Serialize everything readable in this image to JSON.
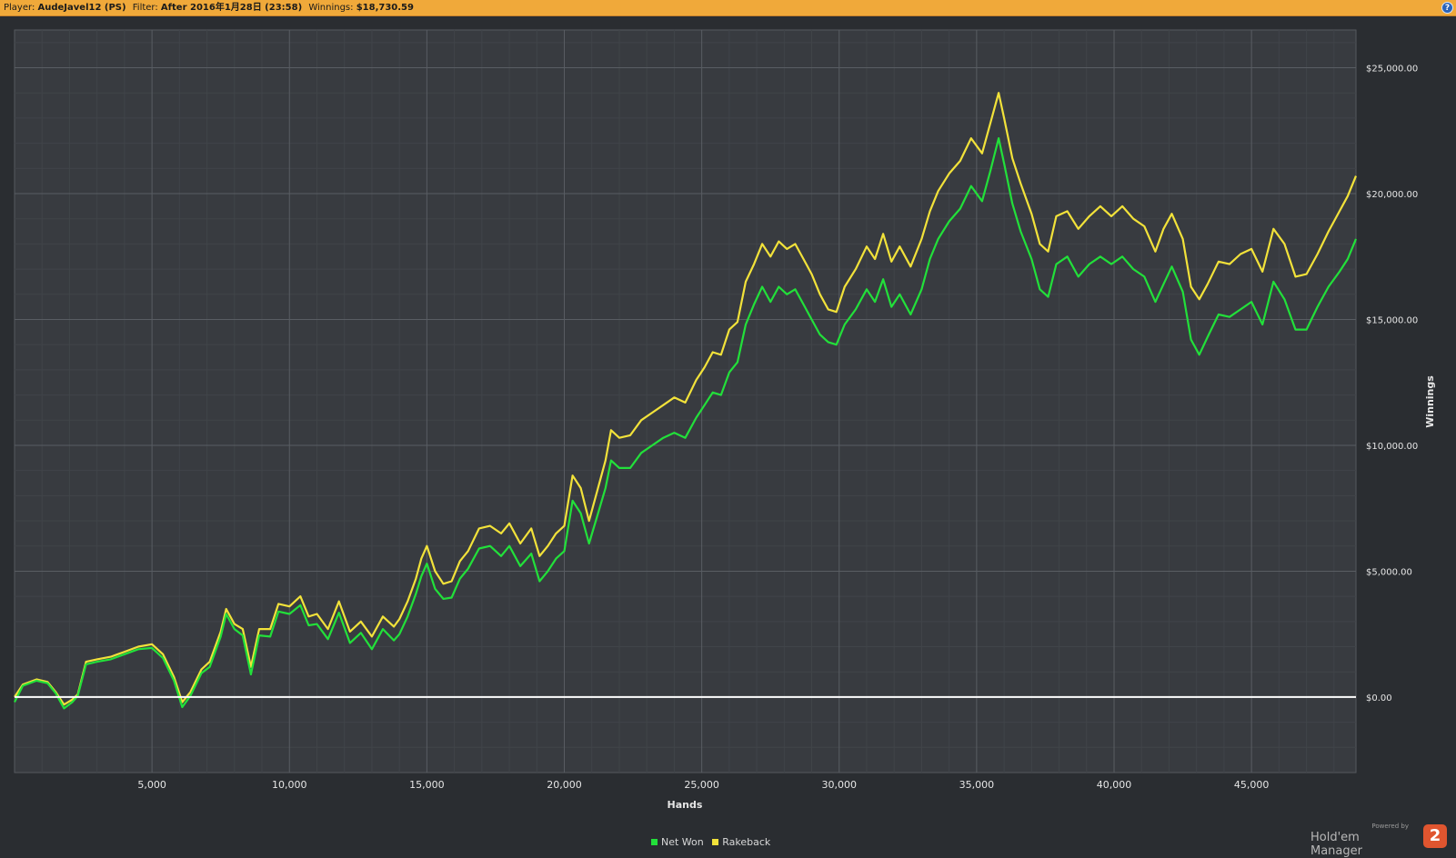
{
  "header": {
    "player_label": "Player:",
    "player_value": "AudeJavel12 (PS)",
    "filter_label": "Filter:",
    "filter_value": "After 2016年1月28日 (23:58)",
    "winnings_label": "Winnings:",
    "winnings_value": "$18,730.59",
    "help_icon": "?"
  },
  "chart_data": {
    "type": "line",
    "xlabel": "Hands",
    "ylabel": "Winnings",
    "xlim": [
      0,
      48800
    ],
    "ylim": [
      -3000,
      26500
    ],
    "x_ticks": [
      {
        "value": 5000,
        "label": "5,000"
      },
      {
        "value": 10000,
        "label": "10,000"
      },
      {
        "value": 15000,
        "label": "15,000"
      },
      {
        "value": 20000,
        "label": "20,000"
      },
      {
        "value": 25000,
        "label": "25,000"
      },
      {
        "value": 30000,
        "label": "30,000"
      },
      {
        "value": 35000,
        "label": "35,000"
      },
      {
        "value": 40000,
        "label": "40,000"
      },
      {
        "value": 45000,
        "label": "45,000"
      }
    ],
    "y_ticks": [
      {
        "value": 0,
        "label": "$0.00"
      },
      {
        "value": 5000,
        "label": "$5,000.00"
      },
      {
        "value": 10000,
        "label": "$10,000.00"
      },
      {
        "value": 15000,
        "label": "$15,000.00"
      },
      {
        "value": 20000,
        "label": "$20,000.00"
      },
      {
        "value": 25000,
        "label": "$25,000.00"
      }
    ],
    "grid": true,
    "legend_position": "bottom-center",
    "colors": {
      "net_won": "#22e03a",
      "rakeback": "#f2e23a",
      "zero_line": "#ffffff",
      "plot_bg": "#383b40",
      "grid": "#4e5257"
    },
    "series": [
      {
        "name": "Rakeback",
        "color": "#f2e23a",
        "points": [
          [
            0,
            0
          ],
          [
            300,
            500
          ],
          [
            800,
            700
          ],
          [
            1200,
            600
          ],
          [
            1500,
            200
          ],
          [
            1800,
            -300
          ],
          [
            2100,
            -100
          ],
          [
            2300,
            100
          ],
          [
            2600,
            1400
          ],
          [
            3000,
            1500
          ],
          [
            3500,
            1600
          ],
          [
            4000,
            1800
          ],
          [
            4500,
            2000
          ],
          [
            5000,
            2100
          ],
          [
            5400,
            1700
          ],
          [
            5800,
            800
          ],
          [
            6100,
            -200
          ],
          [
            6400,
            200
          ],
          [
            6800,
            1100
          ],
          [
            7100,
            1400
          ],
          [
            7500,
            2600
          ],
          [
            7700,
            3500
          ],
          [
            8000,
            2900
          ],
          [
            8300,
            2700
          ],
          [
            8600,
            1200
          ],
          [
            8900,
            2700
          ],
          [
            9300,
            2700
          ],
          [
            9600,
            3700
          ],
          [
            10000,
            3600
          ],
          [
            10400,
            4000
          ],
          [
            10700,
            3200
          ],
          [
            11000,
            3300
          ],
          [
            11400,
            2700
          ],
          [
            11800,
            3800
          ],
          [
            12200,
            2600
          ],
          [
            12600,
            3000
          ],
          [
            13000,
            2400
          ],
          [
            13400,
            3200
          ],
          [
            13800,
            2800
          ],
          [
            14000,
            3100
          ],
          [
            14300,
            3800
          ],
          [
            14600,
            4700
          ],
          [
            14800,
            5500
          ],
          [
            15000,
            6000
          ],
          [
            15300,
            5000
          ],
          [
            15600,
            4500
          ],
          [
            15900,
            4600
          ],
          [
            16200,
            5400
          ],
          [
            16500,
            5800
          ],
          [
            16900,
            6700
          ],
          [
            17300,
            6800
          ],
          [
            17700,
            6500
          ],
          [
            18000,
            6900
          ],
          [
            18400,
            6100
          ],
          [
            18800,
            6700
          ],
          [
            19100,
            5600
          ],
          [
            19400,
            6000
          ],
          [
            19700,
            6500
          ],
          [
            20000,
            6800
          ],
          [
            20300,
            8800
          ],
          [
            20600,
            8300
          ],
          [
            20900,
            7000
          ],
          [
            21200,
            8200
          ],
          [
            21500,
            9400
          ],
          [
            21700,
            10600
          ],
          [
            22000,
            10300
          ],
          [
            22400,
            10400
          ],
          [
            22800,
            11000
          ],
          [
            23200,
            11300
          ],
          [
            23600,
            11600
          ],
          [
            24000,
            11900
          ],
          [
            24400,
            11700
          ],
          [
            24800,
            12600
          ],
          [
            25100,
            13100
          ],
          [
            25400,
            13700
          ],
          [
            25700,
            13600
          ],
          [
            26000,
            14600
          ],
          [
            26300,
            14900
          ],
          [
            26600,
            16500
          ],
          [
            26900,
            17200
          ],
          [
            27200,
            18000
          ],
          [
            27500,
            17500
          ],
          [
            27800,
            18100
          ],
          [
            28100,
            17800
          ],
          [
            28400,
            18000
          ],
          [
            28700,
            17400
          ],
          [
            29000,
            16800
          ],
          [
            29300,
            16000
          ],
          [
            29600,
            15400
          ],
          [
            29900,
            15300
          ],
          [
            30200,
            16300
          ],
          [
            30600,
            17000
          ],
          [
            31000,
            17900
          ],
          [
            31300,
            17400
          ],
          [
            31600,
            18400
          ],
          [
            31900,
            17300
          ],
          [
            32200,
            17900
          ],
          [
            32600,
            17100
          ],
          [
            33000,
            18200
          ],
          [
            33300,
            19300
          ],
          [
            33600,
            20100
          ],
          [
            34000,
            20800
          ],
          [
            34400,
            21300
          ],
          [
            34800,
            22200
          ],
          [
            35200,
            21600
          ],
          [
            35500,
            22800
          ],
          [
            35800,
            24000
          ],
          [
            36000,
            23000
          ],
          [
            36300,
            21400
          ],
          [
            36600,
            20400
          ],
          [
            37000,
            19200
          ],
          [
            37300,
            18000
          ],
          [
            37600,
            17700
          ],
          [
            37900,
            19100
          ],
          [
            38300,
            19300
          ],
          [
            38700,
            18600
          ],
          [
            39100,
            19100
          ],
          [
            39500,
            19500
          ],
          [
            39900,
            19100
          ],
          [
            40300,
            19500
          ],
          [
            40700,
            19000
          ],
          [
            41100,
            18700
          ],
          [
            41500,
            17700
          ],
          [
            41800,
            18600
          ],
          [
            42100,
            19200
          ],
          [
            42500,
            18200
          ],
          [
            42800,
            16300
          ],
          [
            43100,
            15800
          ],
          [
            43400,
            16400
          ],
          [
            43800,
            17300
          ],
          [
            44200,
            17200
          ],
          [
            44600,
            17600
          ],
          [
            45000,
            17800
          ],
          [
            45400,
            16900
          ],
          [
            45800,
            18600
          ],
          [
            46200,
            18000
          ],
          [
            46600,
            16700
          ],
          [
            47000,
            16800
          ],
          [
            47400,
            17600
          ],
          [
            47800,
            18500
          ],
          [
            48200,
            19300
          ],
          [
            48500,
            19900
          ],
          [
            48800,
            20700
          ]
        ]
      },
      {
        "name": "Net Won",
        "color": "#22e03a",
        "points": [
          [
            0,
            -200
          ],
          [
            300,
            450
          ],
          [
            800,
            650
          ],
          [
            1200,
            550
          ],
          [
            1500,
            150
          ],
          [
            1800,
            -450
          ],
          [
            2100,
            -200
          ],
          [
            2300,
            50
          ],
          [
            2600,
            1300
          ],
          [
            3000,
            1400
          ],
          [
            3500,
            1500
          ],
          [
            4000,
            1700
          ],
          [
            4500,
            1900
          ],
          [
            5000,
            1950
          ],
          [
            5400,
            1550
          ],
          [
            5800,
            650
          ],
          [
            6100,
            -400
          ],
          [
            6400,
            50
          ],
          [
            6800,
            950
          ],
          [
            7100,
            1200
          ],
          [
            7500,
            2400
          ],
          [
            7700,
            3300
          ],
          [
            8000,
            2700
          ],
          [
            8300,
            2450
          ],
          [
            8600,
            900
          ],
          [
            8900,
            2450
          ],
          [
            9300,
            2400
          ],
          [
            9600,
            3400
          ],
          [
            10000,
            3300
          ],
          [
            10400,
            3650
          ],
          [
            10700,
            2850
          ],
          [
            11000,
            2900
          ],
          [
            11400,
            2300
          ],
          [
            11800,
            3350
          ],
          [
            12200,
            2150
          ],
          [
            12600,
            2550
          ],
          [
            13000,
            1900
          ],
          [
            13400,
            2700
          ],
          [
            13800,
            2250
          ],
          [
            14000,
            2500
          ],
          [
            14300,
            3200
          ],
          [
            14600,
            4100
          ],
          [
            14800,
            4800
          ],
          [
            15000,
            5300
          ],
          [
            15300,
            4300
          ],
          [
            15600,
            3900
          ],
          [
            15900,
            3950
          ],
          [
            16200,
            4700
          ],
          [
            16500,
            5100
          ],
          [
            16900,
            5900
          ],
          [
            17300,
            6000
          ],
          [
            17700,
            5600
          ],
          [
            18000,
            6000
          ],
          [
            18400,
            5200
          ],
          [
            18800,
            5700
          ],
          [
            19100,
            4600
          ],
          [
            19400,
            5000
          ],
          [
            19700,
            5500
          ],
          [
            20000,
            5800
          ],
          [
            20300,
            7800
          ],
          [
            20600,
            7300
          ],
          [
            20900,
            6100
          ],
          [
            21200,
            7200
          ],
          [
            21500,
            8300
          ],
          [
            21700,
            9400
          ],
          [
            22000,
            9100
          ],
          [
            22400,
            9100
          ],
          [
            22800,
            9700
          ],
          [
            23200,
            10000
          ],
          [
            23600,
            10300
          ],
          [
            24000,
            10500
          ],
          [
            24400,
            10300
          ],
          [
            24800,
            11100
          ],
          [
            25100,
            11600
          ],
          [
            25400,
            12100
          ],
          [
            25700,
            12000
          ],
          [
            26000,
            12900
          ],
          [
            26300,
            13300
          ],
          [
            26600,
            14800
          ],
          [
            26900,
            15600
          ],
          [
            27200,
            16300
          ],
          [
            27500,
            15700
          ],
          [
            27800,
            16300
          ],
          [
            28100,
            16000
          ],
          [
            28400,
            16200
          ],
          [
            28700,
            15600
          ],
          [
            29000,
            15000
          ],
          [
            29300,
            14400
          ],
          [
            29600,
            14100
          ],
          [
            29900,
            14000
          ],
          [
            30200,
            14800
          ],
          [
            30600,
            15400
          ],
          [
            31000,
            16200
          ],
          [
            31300,
            15700
          ],
          [
            31600,
            16600
          ],
          [
            31900,
            15500
          ],
          [
            32200,
            16000
          ],
          [
            32600,
            15200
          ],
          [
            33000,
            16200
          ],
          [
            33300,
            17400
          ],
          [
            33600,
            18200
          ],
          [
            34000,
            18900
          ],
          [
            34400,
            19400
          ],
          [
            34800,
            20300
          ],
          [
            35200,
            19700
          ],
          [
            35500,
            20900
          ],
          [
            35800,
            22200
          ],
          [
            36000,
            21200
          ],
          [
            36300,
            19600
          ],
          [
            36600,
            18500
          ],
          [
            37000,
            17400
          ],
          [
            37300,
            16200
          ],
          [
            37600,
            15900
          ],
          [
            37900,
            17200
          ],
          [
            38300,
            17500
          ],
          [
            38700,
            16700
          ],
          [
            39100,
            17200
          ],
          [
            39500,
            17500
          ],
          [
            39900,
            17200
          ],
          [
            40300,
            17500
          ],
          [
            40700,
            17000
          ],
          [
            41100,
            16700
          ],
          [
            41500,
            15700
          ],
          [
            41800,
            16400
          ],
          [
            42100,
            17100
          ],
          [
            42500,
            16100
          ],
          [
            42800,
            14200
          ],
          [
            43100,
            13600
          ],
          [
            43400,
            14300
          ],
          [
            43800,
            15200
          ],
          [
            44200,
            15100
          ],
          [
            44600,
            15400
          ],
          [
            45000,
            15700
          ],
          [
            45400,
            14800
          ],
          [
            45800,
            16500
          ],
          [
            46200,
            15800
          ],
          [
            46600,
            14600
          ],
          [
            47000,
            14600
          ],
          [
            47400,
            15500
          ],
          [
            47800,
            16300
          ],
          [
            48200,
            16900
          ],
          [
            48500,
            17400
          ],
          [
            48800,
            18200
          ]
        ]
      }
    ]
  },
  "legend": {
    "items": [
      {
        "label": "Net Won",
        "color": "#22e03a"
      },
      {
        "label": "Rakeback",
        "color": "#f2e23a"
      }
    ]
  },
  "branding": {
    "powered_by": "Powered by",
    "product": "Hold'em Manager",
    "logo_text": "2"
  }
}
